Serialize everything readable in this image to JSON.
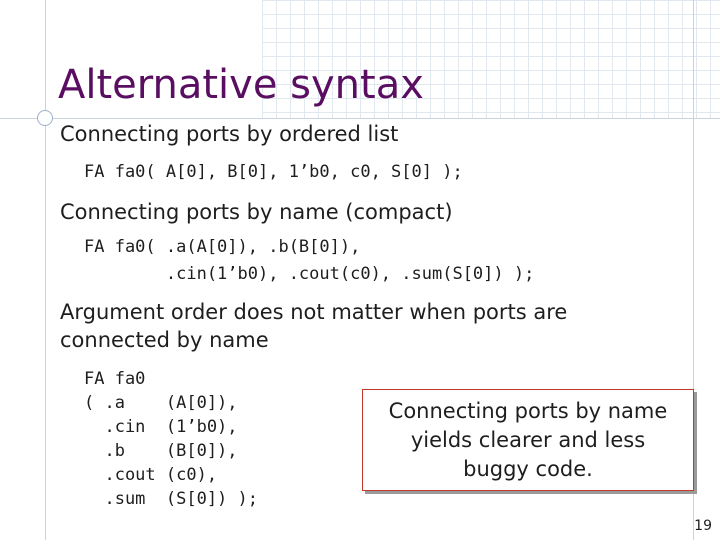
{
  "title": "Alternative syntax",
  "bullets": [
    "Connecting ports by ordered list",
    "Connecting ports by name (compact)",
    "Argument order does not matter when ports are",
    "connected by name"
  ],
  "code": {
    "ordered": "FA fa0( A[0], B[0], 1’b0, c0, S[0] );",
    "named_line1": "FA fa0( .a(A[0]), .b(B[0]),",
    "named_line2": "        .cin(1’b0), .cout(c0), .sum(S[0]) );",
    "long_form": [
      "FA fa0",
      "( .a    (A[0]),",
      "  .cin  (1’b0),",
      "  .b    (B[0]),",
      "  .cout (c0),",
      "  .sum  (S[0]) );"
    ]
  },
  "callout": "Connecting ports by name\nyields clearer and less\nbuggy code.",
  "page_number": "19",
  "colors": {
    "title": "#5a0e62",
    "callout_border": "#c0392b"
  }
}
